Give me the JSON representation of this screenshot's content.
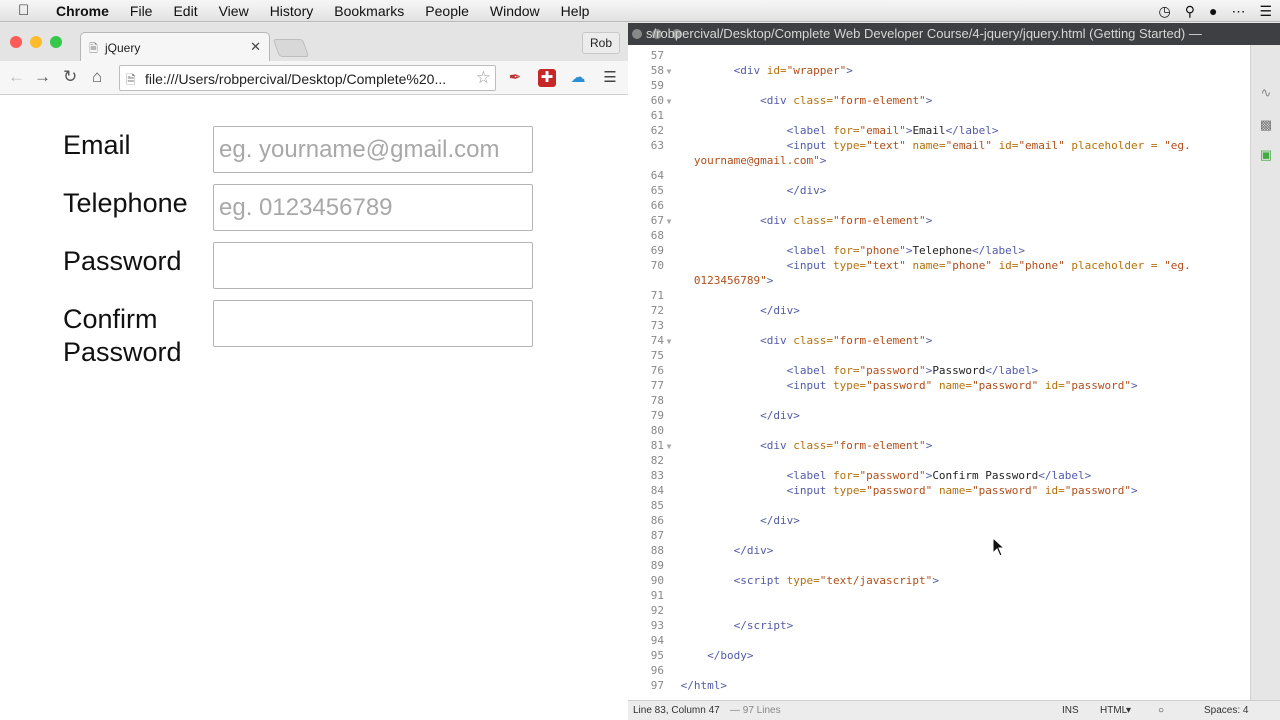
{
  "menubar": {
    "items": [
      "Chrome",
      "File",
      "Edit",
      "View",
      "History",
      "Bookmarks",
      "People",
      "Window",
      "Help"
    ],
    "icons": [
      "timemachine-icon",
      "spotlight-icon",
      "notification-icon",
      "menu-extras-icon",
      "list-icon"
    ]
  },
  "browser": {
    "tab_title": "jQuery",
    "profile": "Rob",
    "url": "file:///Users/robpercival/Desktop/Complete%20...",
    "form": [
      {
        "label": "Email",
        "placeholder": "eg. yourname@gmail.com"
      },
      {
        "label": "Telephone",
        "placeholder": "eg. 0123456789"
      },
      {
        "label": "Password",
        "placeholder": ""
      },
      {
        "label": "Confirm\nPassword",
        "placeholder": ""
      }
    ]
  },
  "editor": {
    "title": "s/robpercival/Desktop/Complete Web Developer Course/4-jquery/jquery.html (Getting Started) —",
    "status": {
      "position": "Line 83, Column 47",
      "lines": "— 97 Lines",
      "mode": "INS",
      "language": "HTML",
      "spaces": "Spaces: 4"
    },
    "lines": [
      {
        "n": "57",
        "fold": false,
        "html": "<span class=\"ct\">        </span>"
      },
      {
        "n": "58",
        "fold": true,
        "html": "        <span class=\"tag\">&lt;div </span><span class=\"attr\">id=</span><span class=\"val\">\"wrapper\"</span><span class=\"tag\">&gt;</span>"
      },
      {
        "n": "59",
        "fold": false,
        "html": ""
      },
      {
        "n": "60",
        "fold": true,
        "html": "            <span class=\"tag\">&lt;div </span><span class=\"attr\">class=</span><span class=\"val\">\"form-element\"</span><span class=\"tag\">&gt;</span>"
      },
      {
        "n": "61",
        "fold": false,
        "html": ""
      },
      {
        "n": "62",
        "fold": false,
        "html": "                <span class=\"tag\">&lt;label </span><span class=\"attr\">for=</span><span class=\"val\">\"email\"</span><span class=\"tag\">&gt;</span><span class=\"txt\">Email</span><span class=\"tag\">&lt;/label&gt;</span>"
      },
      {
        "n": "63",
        "fold": false,
        "html": "                <span class=\"tag\">&lt;input </span><span class=\"attr\">type=</span><span class=\"val\">\"text\"</span> <span class=\"attr\">name=</span><span class=\"val\">\"email\"</span> <span class=\"attr\">id=</span><span class=\"val\">\"email\"</span> <span class=\"attr\">placeholder =</span> <span class=\"val\">\"eg.</span>"
      },
      {
        "n": "",
        "fold": false,
        "html": "<span class=\"val\">yourname@gmail.com\"</span><span class=\"tag\">&gt;</span>"
      },
      {
        "n": "64",
        "fold": false,
        "html": ""
      },
      {
        "n": "65",
        "fold": false,
        "html": "                <span class=\"tag\">&lt;/div&gt;</span>"
      },
      {
        "n": "66",
        "fold": false,
        "html": ""
      },
      {
        "n": "67",
        "fold": true,
        "html": "            <span class=\"tag\">&lt;div </span><span class=\"attr\">class=</span><span class=\"val\">\"form-element\"</span><span class=\"tag\">&gt;</span>"
      },
      {
        "n": "68",
        "fold": false,
        "html": ""
      },
      {
        "n": "69",
        "fold": false,
        "html": "                <span class=\"tag\">&lt;label </span><span class=\"attr\">for=</span><span class=\"val\">\"phone\"</span><span class=\"tag\">&gt;</span><span class=\"txt\">Telephone</span><span class=\"tag\">&lt;/label&gt;</span>"
      },
      {
        "n": "70",
        "fold": false,
        "html": "                <span class=\"tag\">&lt;input </span><span class=\"attr\">type=</span><span class=\"val\">\"text\"</span> <span class=\"attr\">name=</span><span class=\"val\">\"phone\"</span> <span class=\"attr\">id=</span><span class=\"val\">\"phone\"</span> <span class=\"attr\">placeholder =</span> <span class=\"val\">\"eg.</span>"
      },
      {
        "n": "",
        "fold": false,
        "html": "<span class=\"val\">0123456789\"</span><span class=\"tag\">&gt;</span>"
      },
      {
        "n": "71",
        "fold": false,
        "html": ""
      },
      {
        "n": "72",
        "fold": false,
        "html": "            <span class=\"tag\">&lt;/div&gt;</span>"
      },
      {
        "n": "73",
        "fold": false,
        "html": ""
      },
      {
        "n": "74",
        "fold": true,
        "html": "            <span class=\"tag\">&lt;div </span><span class=\"attr\">class=</span><span class=\"val\">\"form-element\"</span><span class=\"tag\">&gt;</span>"
      },
      {
        "n": "75",
        "fold": false,
        "html": ""
      },
      {
        "n": "76",
        "fold": false,
        "html": "                <span class=\"tag\">&lt;label </span><span class=\"attr\">for=</span><span class=\"val\">\"password\"</span><span class=\"tag\">&gt;</span><span class=\"txt\">Password</span><span class=\"tag\">&lt;/label&gt;</span>"
      },
      {
        "n": "77",
        "fold": false,
        "html": "                <span class=\"tag\">&lt;input </span><span class=\"attr\">type=</span><span class=\"val\">\"password\"</span> <span class=\"attr\">name=</span><span class=\"val\">\"password\"</span> <span class=\"attr\">id=</span><span class=\"val\">\"password\"</span><span class=\"tag\">&gt;</span>"
      },
      {
        "n": "78",
        "fold": false,
        "html": ""
      },
      {
        "n": "79",
        "fold": false,
        "html": "            <span class=\"tag\">&lt;/div&gt;</span>"
      },
      {
        "n": "80",
        "fold": false,
        "html": ""
      },
      {
        "n": "81",
        "fold": true,
        "html": "            <span class=\"tag\">&lt;div </span><span class=\"attr\">class=</span><span class=\"val\">\"form-element\"</span><span class=\"tag\">&gt;</span>"
      },
      {
        "n": "82",
        "fold": false,
        "html": ""
      },
      {
        "n": "83",
        "fold": false,
        "html": "                <span class=\"tag\">&lt;label </span><span class=\"attr\">for=</span><span class=\"val\">\"password\"</span><span class=\"tag\">&gt;</span><span class=\"txt\">Confirm Password</span><span class=\"tag\">&lt;/label&gt;</span>"
      },
      {
        "n": "84",
        "fold": false,
        "html": "                <span class=\"tag\">&lt;input </span><span class=\"attr\">type=</span><span class=\"val\">\"password\"</span> <span class=\"attr\">name=</span><span class=\"val\">\"password\"</span> <span class=\"attr\">id=</span><span class=\"val\">\"password\"</span><span class=\"tag\">&gt;</span>"
      },
      {
        "n": "85",
        "fold": false,
        "html": ""
      },
      {
        "n": "86",
        "fold": false,
        "html": "            <span class=\"tag\">&lt;/div&gt;</span>"
      },
      {
        "n": "87",
        "fold": false,
        "html": ""
      },
      {
        "n": "88",
        "fold": false,
        "html": "        <span class=\"tag\">&lt;/div&gt;</span>"
      },
      {
        "n": "89",
        "fold": false,
        "html": ""
      },
      {
        "n": "90",
        "fold": false,
        "html": "        <span class=\"tag\">&lt;script </span><span class=\"attr\">type=</span><span class=\"val\">\"text/javascript\"</span><span class=\"tag\">&gt;</span>"
      },
      {
        "n": "91",
        "fold": false,
        "html": ""
      },
      {
        "n": "92",
        "fold": false,
        "html": ""
      },
      {
        "n": "93",
        "fold": false,
        "html": "        <span class=\"tag\">&lt;/script&gt;</span>"
      },
      {
        "n": "94",
        "fold": false,
        "html": ""
      },
      {
        "n": "95",
        "fold": false,
        "html": "    <span class=\"tag\">&lt;/body&gt;</span>"
      },
      {
        "n": "96",
        "fold": false,
        "html": ""
      },
      {
        "n": "97",
        "fold": false,
        "html": "<span class=\"tag\">&lt;/html&gt;</span>"
      }
    ]
  }
}
